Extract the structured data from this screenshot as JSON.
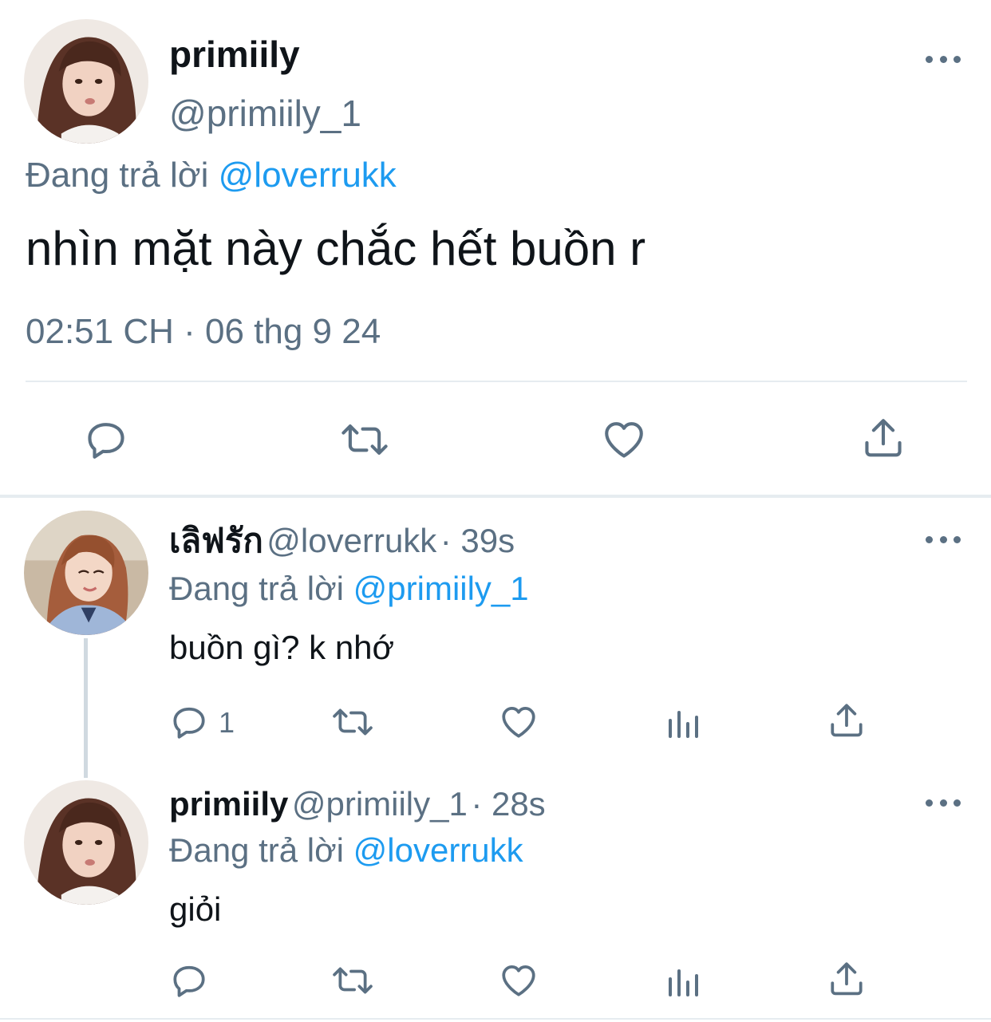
{
  "main_tweet": {
    "display_name": "primiily",
    "handle": "@primiily_1",
    "replying_prefix": "Đang trả lời",
    "replying_to": "@loverrukk",
    "text": "nhìn mặt này chắc hết buồn r",
    "timestamp": "02:51 CH · 06 thg 9 24"
  },
  "replies": [
    {
      "display_name": "เลิฟรัก",
      "handle": "@loverrukk",
      "time": "· 39s",
      "replying_prefix": "Đang trả lời",
      "replying_to": "@primiily_1",
      "text": "buồn gì? k nhớ",
      "reply_count": "1"
    },
    {
      "display_name": "primiily",
      "handle": "@primiily_1",
      "time": "· 28s",
      "replying_prefix": "Đang trả lời",
      "replying_to": "@loverrukk",
      "text": "giỏi",
      "reply_count": ""
    }
  ],
  "icons": {
    "reply": "reply-icon",
    "retweet": "retweet-icon",
    "like": "heart-icon",
    "share": "share-icon",
    "analytics": "analytics-icon",
    "more": "more-icon"
  },
  "colors": {
    "link": "#1d9bf0",
    "muted": "#5b7083",
    "divider": "#e6ecf0"
  }
}
